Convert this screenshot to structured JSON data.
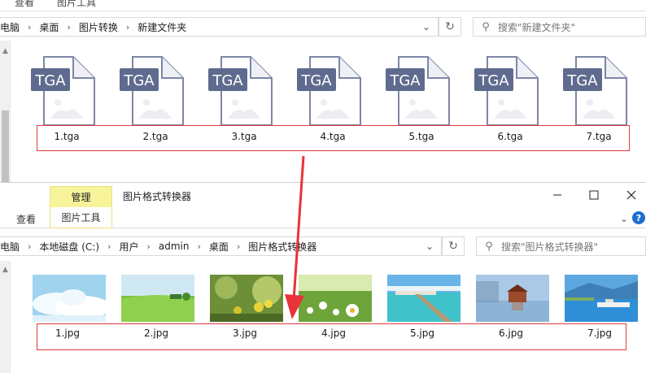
{
  "top_window": {
    "ribbon_tabs": [
      "查看",
      "图片工具"
    ],
    "breadcrumbs": [
      "电脑",
      "桌面",
      "图片转换",
      "新建文件夹"
    ],
    "search_placeholder": "搜索\"新建文件夹\"",
    "files": [
      {
        "name": "1.tga",
        "badge": "TGA"
      },
      {
        "name": "2.tga",
        "badge": "TGA"
      },
      {
        "name": "3.tga",
        "badge": "TGA"
      },
      {
        "name": "4.tga",
        "badge": "TGA"
      },
      {
        "name": "5.tga",
        "badge": "TGA"
      },
      {
        "name": "6.tga",
        "badge": "TGA"
      },
      {
        "name": "7.tga",
        "badge": "TGA"
      }
    ]
  },
  "bottom_window": {
    "manage_tab": "管理",
    "title": "图片格式转换器",
    "ribbon_tabs": {
      "view": "查看",
      "picture_tools": "图片工具"
    },
    "breadcrumbs": [
      "电脑",
      "本地磁盘 (C:)",
      "用户",
      "admin",
      "桌面",
      "图片格式转换器"
    ],
    "search_placeholder": "搜索\"图片格式转换器\"",
    "files": [
      {
        "name": "1.jpg",
        "scene": "sky-clouds"
      },
      {
        "name": "2.jpg",
        "scene": "green-field"
      },
      {
        "name": "3.jpg",
        "scene": "yellow-flowers"
      },
      {
        "name": "4.jpg",
        "scene": "daisies"
      },
      {
        "name": "5.jpg",
        "scene": "ocean-pier"
      },
      {
        "name": "6.jpg",
        "scene": "lake-house"
      },
      {
        "name": "7.jpg",
        "scene": "harbor"
      }
    ]
  },
  "colors": {
    "highlight_box": "#e0393e",
    "arrow": "#e8333a",
    "manage_tab": "#f7f39a",
    "tga_badge": "#5f6b8e"
  },
  "icons": {
    "back": "chevron-right-icon",
    "dropdown": "chevron-down-icon",
    "refresh": "refresh-icon",
    "search": "search-icon",
    "minimize": "minimize-icon",
    "maximize": "maximize-icon",
    "close": "close-icon",
    "help": "help-icon"
  }
}
